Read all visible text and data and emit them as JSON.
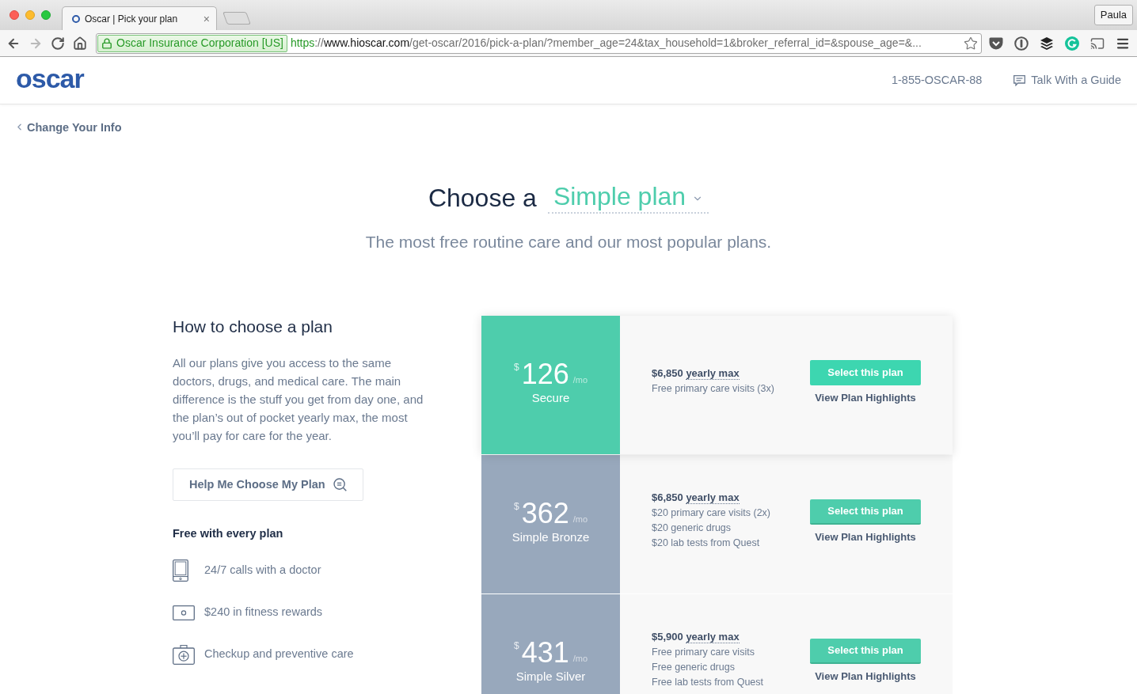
{
  "browser": {
    "tab": {
      "title": "Oscar | Pick your plan",
      "close": "×"
    },
    "profile": "Paula",
    "forward_button": {
      "disabled": true
    },
    "security_badge": "Oscar Insurance Corporation [US]",
    "url": [
      {
        "kind": "scheme",
        "text": "https"
      },
      {
        "kind": "plain",
        "text": "://"
      },
      {
        "kind": "host",
        "text": "www.hioscar.com"
      },
      {
        "kind": "plain",
        "text": "/get-oscar/2016/pick-a-plan/?member_age=24&tax_household=1&broker_referral_id=&spouse_age=&..."
      }
    ]
  },
  "header": {
    "logo": "oscar",
    "phone": "1-855-OSCAR-88",
    "guide_link": "Talk With a Guide"
  },
  "back_link": "Change Your Info",
  "hero": {
    "title_prefix": "Choose a",
    "plan_type": "Simple plan",
    "subtitle": "The most free routine care and our most popular plans."
  },
  "guide": {
    "title": "How to choose a plan",
    "body": "All our plans give you access to the same doctors, drugs, and medical care. The main difference is the stuff you get from day one, and the plan’s out of pocket yearly max, the most you’ll pay for care for the year.",
    "help_button": "Help Me Choose My Plan",
    "free_heading": "Free with every plan",
    "features": [
      {
        "text": "24/7 calls with a doctor"
      },
      {
        "text": "$240 in fitness rewards"
      },
      {
        "text": "Checkup and preventive care"
      }
    ]
  },
  "plans": [
    {
      "selected": true,
      "currency": "$",
      "price": "126",
      "period": "/mo",
      "name": "Secure",
      "max_amount": "$6,850",
      "max_label": "yearly max",
      "benefits": [
        "Free primary care visits (3x)"
      ],
      "select_button": "Select this plan",
      "highlights_link": "View Plan Highlights"
    },
    {
      "selected": false,
      "currency": "$",
      "price": "362",
      "period": "/mo",
      "name": "Simple Bronze",
      "max_amount": "$6,850",
      "max_label": "yearly max",
      "benefits": [
        "$20 primary care visits (2x)",
        "$20 generic drugs",
        "$20 lab tests from Quest"
      ],
      "select_button": "Select this plan",
      "highlights_link": "View Plan Highlights"
    },
    {
      "selected": false,
      "currency": "$",
      "price": "431",
      "period": "/mo",
      "name": "Simple Silver",
      "max_amount": "$5,900",
      "max_label": "yearly max",
      "benefits": [
        "Free primary care visits",
        "Free generic drugs",
        "Free lab tests from Quest"
      ],
      "select_button": "Select this plan",
      "highlights_link": "View Plan Highlights"
    }
  ]
}
